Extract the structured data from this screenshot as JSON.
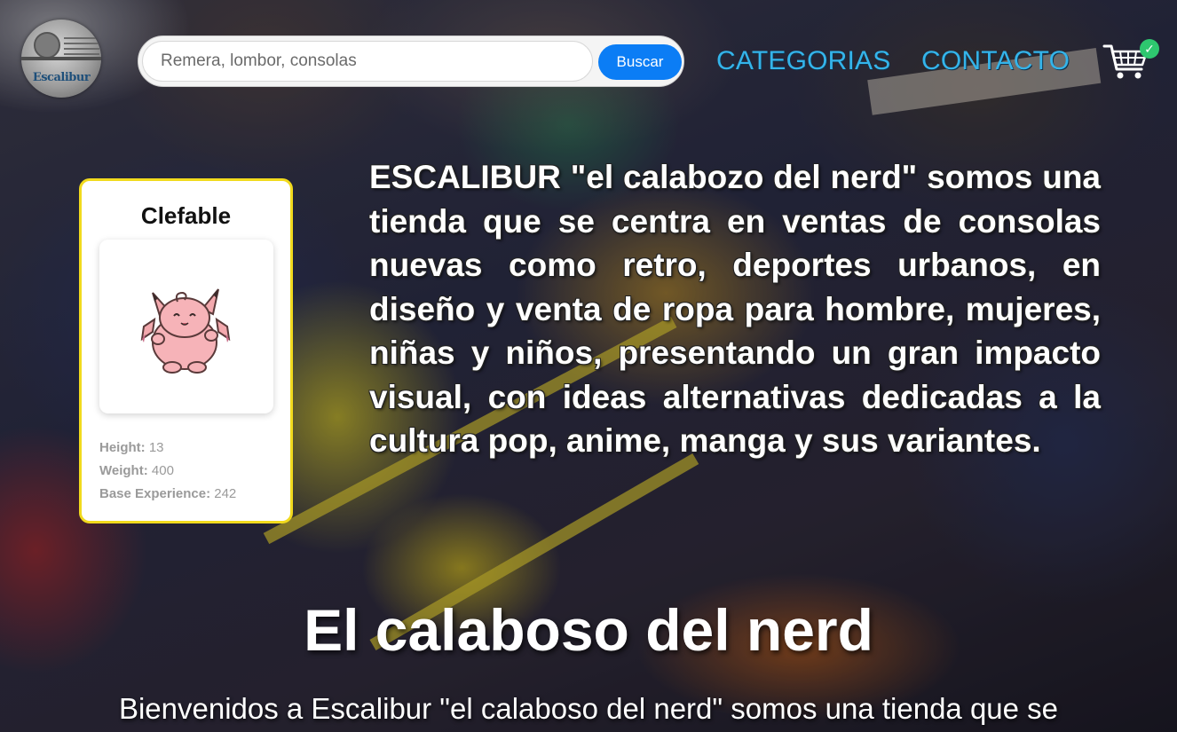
{
  "header": {
    "logo_text": "Escalibur",
    "search": {
      "placeholder": "Remera, lombor, consolas",
      "button_label": "Buscar"
    },
    "nav": [
      {
        "label": "CATEGORIAS"
      },
      {
        "label": "CONTACTO"
      }
    ],
    "cart": {
      "icon": "cart-icon",
      "badge": "✓"
    }
  },
  "pokemon_card": {
    "name": "Clefable",
    "image_icon": "clefable-sprite",
    "stats": [
      {
        "label": "Height:",
        "value": "13"
      },
      {
        "label": "Weight:",
        "value": "400"
      },
      {
        "label": "Base Experience:",
        "value": "242"
      }
    ]
  },
  "description": "ESCALIBUR \"el calabozo del nerd\" somos una tienda que se centra en ventas de consolas nuevas como retro, deportes urbanos, en diseño y venta de ropa para hombre, mujeres, niñas y niños, presentando un gran impacto visual, con ideas alternativas dedicadas a la cultura pop, anime, manga y sus variantes.",
  "hero": {
    "title": "El calaboso del nerd",
    "subtitle": "Bienvenidos a Escalibur \"el calaboso del nerd\" somos una tienda que se"
  },
  "colors": {
    "nav_link": "#34b4ea",
    "search_button": "#0b7df5",
    "card_border": "#f1da1d",
    "cart_badge": "#2ec76f"
  }
}
